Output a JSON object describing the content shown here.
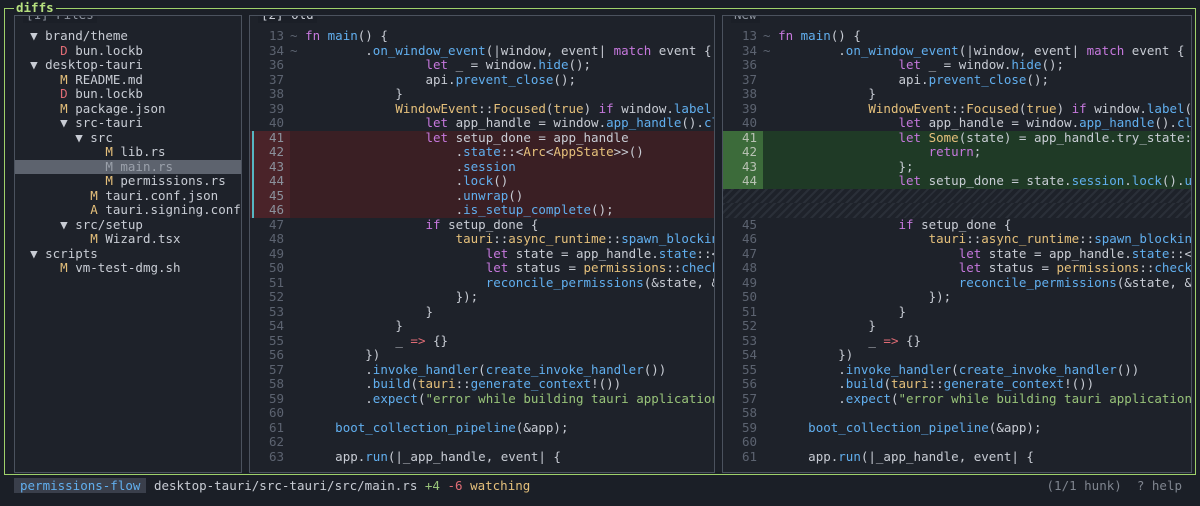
{
  "app": {
    "title": "diffs"
  },
  "panes": {
    "files": {
      "title": "[1] Files"
    },
    "old": {
      "title": "[2] Old"
    },
    "new": {
      "title": "New"
    }
  },
  "tree": [
    {
      "indent": "  ",
      "arrow": "▼ ",
      "status": "",
      "name": "brand/theme",
      "selected": false
    },
    {
      "indent": "      ",
      "arrow": "",
      "status": "D",
      "name": "bun.lockb",
      "selected": false
    },
    {
      "indent": "  ",
      "arrow": "▼ ",
      "status": "",
      "name": "desktop-tauri",
      "selected": false
    },
    {
      "indent": "      ",
      "arrow": "",
      "status": "M",
      "name": "README.md",
      "selected": false
    },
    {
      "indent": "      ",
      "arrow": "",
      "status": "D",
      "name": "bun.lockb",
      "selected": false
    },
    {
      "indent": "      ",
      "arrow": "",
      "status": "M",
      "name": "package.json",
      "selected": false
    },
    {
      "indent": "      ",
      "arrow": "▼ ",
      "status": "",
      "name": "src-tauri",
      "selected": false
    },
    {
      "indent": "        ",
      "arrow": "▼ ",
      "status": "",
      "name": "src",
      "selected": false
    },
    {
      "indent": "            ",
      "arrow": "",
      "status": "M",
      "name": "lib.rs",
      "selected": false
    },
    {
      "indent": "            ",
      "arrow": "",
      "status": "M",
      "name": "main.rs",
      "selected": true
    },
    {
      "indent": "            ",
      "arrow": "",
      "status": "M",
      "name": "permissions.rs",
      "selected": false
    },
    {
      "indent": "          ",
      "arrow": "",
      "status": "M",
      "name": "tauri.conf.json",
      "selected": false
    },
    {
      "indent": "          ",
      "arrow": "",
      "status": "A",
      "name": "tauri.signing.conf.json",
      "selected": false
    },
    {
      "indent": "      ",
      "arrow": "▼ ",
      "status": "",
      "name": "src/setup",
      "selected": false
    },
    {
      "indent": "          ",
      "arrow": "",
      "status": "M",
      "name": "Wizard.tsx",
      "selected": false
    },
    {
      "indent": "  ",
      "arrow": "▼ ",
      "status": "",
      "name": "scripts",
      "selected": false
    },
    {
      "indent": "      ",
      "arrow": "",
      "status": "M",
      "name": "vm-test-dmg.sh",
      "selected": false
    }
  ],
  "old_lines": [
    {
      "ln": "13",
      "mark": "~",
      "type": "ctx",
      "code": "fn main() {"
    },
    {
      "ln": "34",
      "mark": "~",
      "type": "ctx",
      "code": "        .on_window_event(|window, event| match event {"
    },
    {
      "ln": "36",
      "mark": "",
      "type": "ctx",
      "code": "                let _ = window.hide();"
    },
    {
      "ln": "37",
      "mark": "",
      "type": "ctx",
      "code": "                api.prevent_close();"
    },
    {
      "ln": "38",
      "mark": "",
      "type": "ctx",
      "code": "            }"
    },
    {
      "ln": "39",
      "mark": "",
      "type": "ctx",
      "code": "            WindowEvent::Focused(true) if window.label() == \"m"
    },
    {
      "ln": "40",
      "mark": "",
      "type": "ctx",
      "code": "                let app_handle = window.app_handle().clone();"
    },
    {
      "ln": "41",
      "mark": "",
      "type": "del",
      "code": "                let setup_done = app_handle"
    },
    {
      "ln": "42",
      "mark": "",
      "type": "del",
      "code": "                    .state::<Arc<AppState>>()"
    },
    {
      "ln": "43",
      "mark": "",
      "type": "del",
      "code": "                    .session"
    },
    {
      "ln": "44",
      "mark": "",
      "type": "del",
      "code": "                    .lock()"
    },
    {
      "ln": "45",
      "mark": "",
      "type": "del",
      "code": "                    .unwrap()"
    },
    {
      "ln": "46",
      "mark": "",
      "type": "del",
      "code": "                    .is_setup_complete();"
    },
    {
      "ln": "47",
      "mark": "",
      "type": "ctx",
      "code": "                if setup_done {"
    },
    {
      "ln": "48",
      "mark": "",
      "type": "ctx",
      "code": "                    tauri::async_runtime::spawn_blocking(move"
    },
    {
      "ln": "49",
      "mark": "",
      "type": "ctx",
      "code": "                        let state = app_handle.state::<Arc<App"
    },
    {
      "ln": "50",
      "mark": "",
      "type": "ctx",
      "code": "                        let status = permissions::check_all();"
    },
    {
      "ln": "51",
      "mark": "",
      "type": "ctx",
      "code": "                        reconcile_permissions(&state, &status)"
    },
    {
      "ln": "52",
      "mark": "",
      "type": "ctx",
      "code": "                    });"
    },
    {
      "ln": "53",
      "mark": "",
      "type": "ctx",
      "code": "                }"
    },
    {
      "ln": "54",
      "mark": "",
      "type": "ctx",
      "code": "            }"
    },
    {
      "ln": "55",
      "mark": "",
      "type": "ctx",
      "code": "            _ => {}"
    },
    {
      "ln": "56",
      "mark": "",
      "type": "ctx",
      "code": "        })"
    },
    {
      "ln": "57",
      "mark": "",
      "type": "ctx",
      "code": "        .invoke_handler(create_invoke_handler())"
    },
    {
      "ln": "58",
      "mark": "",
      "type": "ctx",
      "code": "        .build(tauri::generate_context!())"
    },
    {
      "ln": "59",
      "mark": "",
      "type": "ctx",
      "code": "        .expect(\"error while building tauri application\");"
    },
    {
      "ln": "60",
      "mark": "",
      "type": "ctx",
      "code": ""
    },
    {
      "ln": "61",
      "mark": "",
      "type": "ctx",
      "code": "    boot_collection_pipeline(&app);"
    },
    {
      "ln": "62",
      "mark": "",
      "type": "ctx",
      "code": ""
    },
    {
      "ln": "63",
      "mark": "",
      "type": "ctx",
      "code": "    app.run(|_app_handle, event| {"
    }
  ],
  "new_lines": [
    {
      "ln": "13",
      "mark": "~",
      "type": "ctx",
      "code": "fn main() {"
    },
    {
      "ln": "34",
      "mark": "~",
      "type": "ctx",
      "code": "        .on_window_event(|window, event| match event {"
    },
    {
      "ln": "36",
      "mark": "",
      "type": "ctx",
      "code": "                let _ = window.hide();"
    },
    {
      "ln": "37",
      "mark": "",
      "type": "ctx",
      "code": "                api.prevent_close();"
    },
    {
      "ln": "38",
      "mark": "",
      "type": "ctx",
      "code": "            }"
    },
    {
      "ln": "39",
      "mark": "",
      "type": "ctx",
      "code": "            WindowEvent::Focused(true) if window.label() == \"ma"
    },
    {
      "ln": "40",
      "mark": "",
      "type": "ctx",
      "code": "                let app_handle = window.app_handle().clone();"
    },
    {
      "ln": "41",
      "mark": "",
      "type": "add",
      "code": "                let Some(state) = app_handle.try_state::<Arc<Ap"
    },
    {
      "ln": "42",
      "mark": "",
      "type": "add",
      "code": "                    return;"
    },
    {
      "ln": "43",
      "mark": "",
      "type": "add",
      "code": "                };"
    },
    {
      "ln": "44",
      "mark": "",
      "type": "add",
      "code": "                let setup_done = state.session.lock().unwrap()."
    },
    {
      "ln": "",
      "mark": "",
      "type": "filler",
      "code": ""
    },
    {
      "ln": "",
      "mark": "",
      "type": "filler",
      "code": ""
    },
    {
      "ln": "45",
      "mark": "",
      "type": "ctx",
      "code": "                if setup_done {"
    },
    {
      "ln": "46",
      "mark": "",
      "type": "ctx",
      "code": "                    tauri::async_runtime::spawn_blocking(move |"
    },
    {
      "ln": "47",
      "mark": "",
      "type": "ctx",
      "code": "                        let state = app_handle.state::<Arc<AppS"
    },
    {
      "ln": "48",
      "mark": "",
      "type": "ctx",
      "code": "                        let status = permissions::check_all();"
    },
    {
      "ln": "49",
      "mark": "",
      "type": "ctx",
      "code": "                        reconcile_permissions(&state, &status);"
    },
    {
      "ln": "50",
      "mark": "",
      "type": "ctx",
      "code": "                    });"
    },
    {
      "ln": "51",
      "mark": "",
      "type": "ctx",
      "code": "                }"
    },
    {
      "ln": "52",
      "mark": "",
      "type": "ctx",
      "code": "            }"
    },
    {
      "ln": "53",
      "mark": "",
      "type": "ctx",
      "code": "            _ => {}"
    },
    {
      "ln": "54",
      "mark": "",
      "type": "ctx",
      "code": "        })"
    },
    {
      "ln": "55",
      "mark": "",
      "type": "ctx",
      "code": "        .invoke_handler(create_invoke_handler())"
    },
    {
      "ln": "56",
      "mark": "",
      "type": "ctx",
      "code": "        .build(tauri::generate_context!())"
    },
    {
      "ln": "57",
      "mark": "",
      "type": "ctx",
      "code": "        .expect(\"error while building tauri application\");"
    },
    {
      "ln": "58",
      "mark": "",
      "type": "ctx",
      "code": ""
    },
    {
      "ln": "59",
      "mark": "",
      "type": "ctx",
      "code": "    boot_collection_pipeline(&app);"
    },
    {
      "ln": "60",
      "mark": "",
      "type": "ctx",
      "code": ""
    },
    {
      "ln": "61",
      "mark": "",
      "type": "ctx",
      "code": "    app.run(|_app_handle, event| {"
    }
  ],
  "status": {
    "branch": "permissions-flow",
    "path": "desktop-tauri/src-tauri/src/main.rs",
    "adds": "+4",
    "dels": "-6",
    "state": "watching",
    "hunk": "(1/1 hunk)",
    "help": "? help"
  },
  "colors": {
    "accent": "#9fd16a",
    "added": "#98c379",
    "removed": "#e06c75",
    "modified": "#e5c07b"
  }
}
